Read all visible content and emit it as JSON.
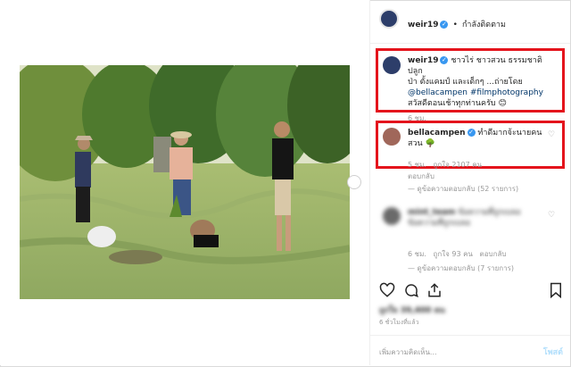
{
  "header": {
    "username": "weir19",
    "dot": "•",
    "follow_status": "กำลังติดตาม"
  },
  "caption": {
    "username": "weir19",
    "text_line1": "ชาวไร่ ชาวสวน ธรรมชาติ ปลูก",
    "text_line2": "ป่า ตั้งแคมป์ และเด็กๆ ...ถ่ายโดย",
    "mention": "@bellacampen",
    "hashtag": "#filmphotography",
    "text_line4": "สวัสดีตอนเช้าทุกท่านครับ 😊",
    "time": "6 ชม."
  },
  "comment1": {
    "username": "bellacampen",
    "text_line1": "ทำดีมากจ้ะนายคน",
    "text_line2": "สวน 🌳",
    "time": "5 ชม.",
    "likes": "ถูกใจ 2107 คน",
    "reply": "ตอบกลับ",
    "view_replies": "ดูข้อความตอบกลับ (52 รายการ)"
  },
  "comment2": {
    "username": "mint_team",
    "text_line1": "ข้อความที่ถูกเบลอ",
    "text_line2": "ข้อความที่ถูกเบลอ",
    "time": "6 ชม.",
    "likes": "ถูกใจ 93 คน",
    "reply": "ตอบกลับ",
    "view_replies": "ดูข้อความตอบกลับ (7 รายการ)"
  },
  "likes_blur": "ถูกใจ 39,400 คน",
  "post_time": "6 ชั่วโมงที่แล้ว",
  "comment_input": {
    "placeholder": "เพิ่มความคิดเห็น...",
    "post_label": "โพสต์"
  },
  "icons": {
    "heart": "heart-icon",
    "comment": "comment-icon",
    "share": "share-icon",
    "bookmark": "bookmark-icon",
    "next": "chevron-right-icon"
  },
  "colors": {
    "highlight": "#e4141c",
    "verified": "#3897f0",
    "link": "#003569"
  }
}
